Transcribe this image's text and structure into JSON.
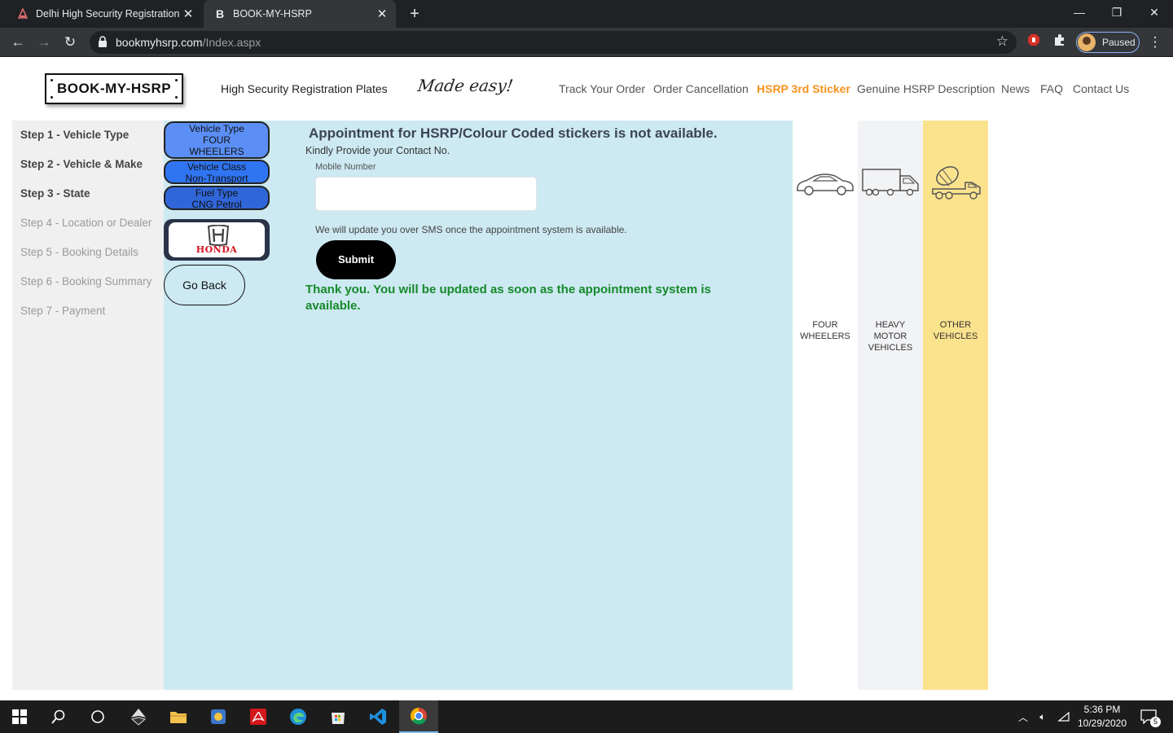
{
  "browser": {
    "tabs": [
      {
        "title": "Delhi High Security Registration P",
        "active": false
      },
      {
        "title": "BOOK-MY-HSRP",
        "active": true
      }
    ],
    "url_host": "bookmyhsrp.com",
    "url_path": "/Index.aspx",
    "profile_status": "Paused"
  },
  "header": {
    "logo": "BOOK-MY-HSRP",
    "tagline": "High Security Registration Plates",
    "slogan": "Made easy!",
    "nav": [
      {
        "label": "Track Your Order",
        "active": false
      },
      {
        "label": "Order Cancellation",
        "active": false
      },
      {
        "label": "HSRP 3rd Sticker",
        "active": true
      },
      {
        "label": "Genuine HSRP Description",
        "active": false
      },
      {
        "label": "News",
        "active": false
      },
      {
        "label": "FAQ",
        "active": false
      },
      {
        "label": "Contact Us",
        "active": false
      }
    ]
  },
  "steps": [
    {
      "label": "Step 1 - Vehicle Type",
      "done": true
    },
    {
      "label": "Step 2 - Vehicle & Make",
      "done": true
    },
    {
      "label": "Step 3 - State",
      "done": true
    },
    {
      "label": "Step 4 - Location or Dealer",
      "done": false
    },
    {
      "label": "Step 5 - Booking Details",
      "done": false
    },
    {
      "label": "Step 6 - Booking Summary",
      "done": false
    },
    {
      "label": "Step 7 - Payment",
      "done": false
    }
  ],
  "selection": {
    "vehicle_type_label": "Vehicle Type",
    "vehicle_type_value_1": "FOUR",
    "vehicle_type_value_2": "WHEELERS",
    "vehicle_class_label": "Vehicle Class",
    "vehicle_class_value": "Non-Transport",
    "fuel_type_label": "Fuel Type",
    "fuel_type_value": "CNG Petrol",
    "brand": "HONDA",
    "go_back": "Go Back"
  },
  "form": {
    "title": "Appointment for HSRP/Colour Coded stickers is not available.",
    "subtitle": "Kindly Provide your Contact No.",
    "mobile_label": "Mobile Number",
    "mobile_value": "",
    "sms_note": "We will update you over SMS once the appointment system is available.",
    "submit": "Submit",
    "thanks": "Thank you. You will be updated as soon as the appointment system is available."
  },
  "vehicle_columns": [
    {
      "label_1": "FOUR",
      "label_2": "WHEELERS",
      "label_3": "",
      "bg": "#ffffff"
    },
    {
      "label_1": "HEAVY",
      "label_2": "MOTOR",
      "label_3": "VEHICLES",
      "bg": "#f2f3f5"
    },
    {
      "label_1": "OTHER",
      "label_2": "VEHICLES",
      "label_3": "",
      "bg": "#fbe38e"
    }
  ],
  "colors": {
    "accent_nav": "#f7931e",
    "main_bg": "#cde9f2",
    "success_text": "#158a2a"
  },
  "taskbar": {
    "time": "5:36 PM",
    "date": "10/29/2020",
    "notifications": "5"
  }
}
